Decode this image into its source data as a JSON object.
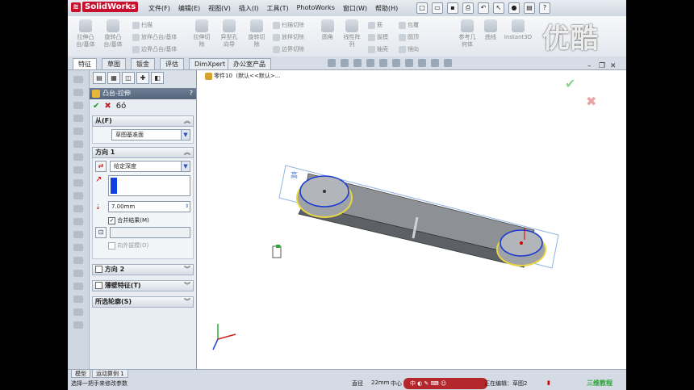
{
  "app": {
    "logo": "SolidWorks"
  },
  "menu": [
    "文件(F)",
    "编辑(E)",
    "视图(V)",
    "插入(I)",
    "工具(T)",
    "PhotoWorks",
    "窗口(W)",
    "帮助(H)"
  ],
  "ribbon": {
    "big_buttons": [
      {
        "label": "拉伸凸\n台/基体",
        "icon": "extrude-boss-icon"
      },
      {
        "label": "旋转凸\n台/基体",
        "icon": "revolve-boss-icon"
      },
      {
        "label": "拉伸切\n除",
        "icon": "extrude-cut-icon"
      },
      {
        "label": "异型孔\n向导",
        "icon": "hole-wizard-icon"
      },
      {
        "label": "旋转切\n除",
        "icon": "revolve-cut-icon"
      },
      {
        "label": "圆角",
        "icon": "fillet-icon"
      },
      {
        "label": "线性阵\n列",
        "icon": "linear-pattern-icon"
      },
      {
        "label": "参考几\n何体",
        "icon": "reference-geometry-icon"
      },
      {
        "label": "曲线",
        "icon": "curves-icon"
      },
      {
        "label": "Instant3D",
        "icon": "instant3d-icon"
      }
    ],
    "small_buttons": [
      {
        "label": "扫描"
      },
      {
        "label": "放样凸台/基体"
      },
      {
        "label": "边界凸台/基体"
      },
      {
        "label": "扫描切除"
      },
      {
        "label": "放样切除"
      },
      {
        "label": "边界切除"
      },
      {
        "label": "筋"
      },
      {
        "label": "拔模"
      },
      {
        "label": "抽壳"
      },
      {
        "label": "包覆"
      },
      {
        "label": "圆顶"
      },
      {
        "label": "镜向"
      }
    ]
  },
  "tabs": [
    "特征",
    "草图",
    "钣金",
    "评估",
    "DimXpert",
    "办公室产品"
  ],
  "property_manager": {
    "title": "凸台-拉伸",
    "help": "?",
    "from": {
      "title": "从(F)",
      "value": "草图基准面"
    },
    "direction1": {
      "title": "方向 1",
      "end_condition": "给定深度",
      "depth": "7.00mm",
      "merge_result": "合并结果(M)",
      "draft_outward": "向外拔模(O)"
    },
    "direction2": {
      "title": "方向 2"
    },
    "thin_feature": {
      "title": "薄壁特征(T)"
    },
    "selected_contours": {
      "title": "所选轮廓(S)"
    }
  },
  "feature_tree": {
    "root": "零件10",
    "config": "(默认<<默认>..."
  },
  "bottom_tabs": [
    "模型",
    "运动算例 1"
  ],
  "status": {
    "message": "选择一把手来修改参数",
    "field1": "直径",
    "field2": "22mm",
    "field3": "中心",
    "ime": "中",
    "editing": "正在编辑：草图2",
    "corner": "三维教程"
  },
  "watermark": "优酷",
  "colors": {
    "accent_red": "#c8102e",
    "confirm_green": "#1b9a2b",
    "selection_blue": "#1040e0",
    "preview_yellow": "#e6d640"
  }
}
